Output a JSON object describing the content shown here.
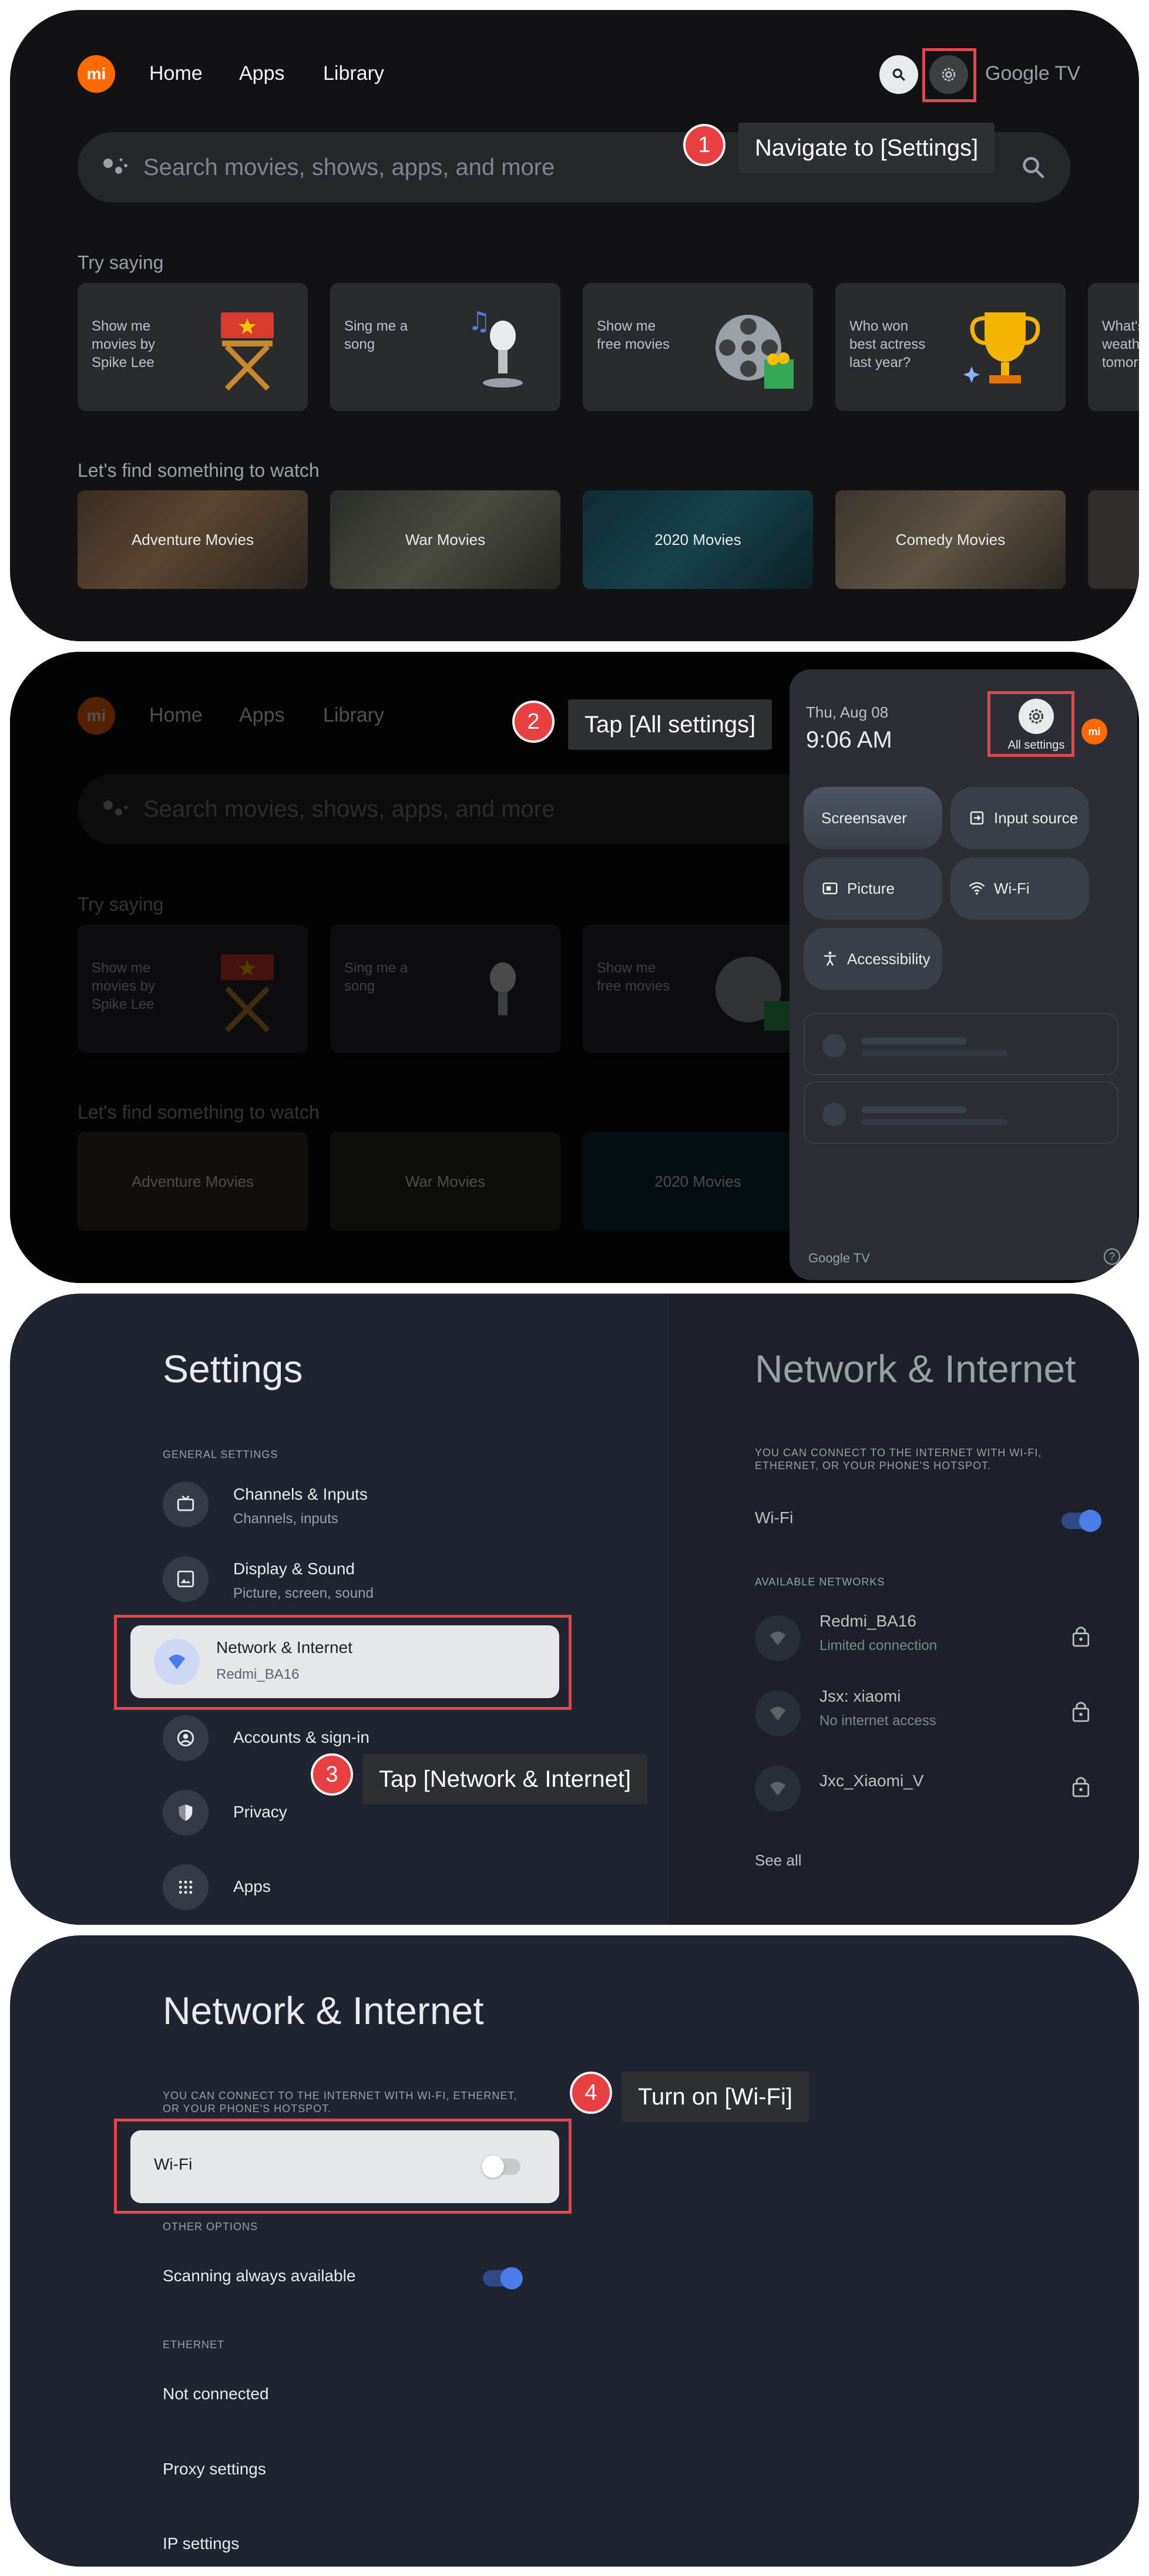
{
  "app": {
    "brand": "Google TV",
    "logo_text": "mi",
    "nav": [
      "Home",
      "Apps",
      "Library"
    ],
    "search_placeholder": "Search movies, shows, apps, and more"
  },
  "home": {
    "try_saying_title": "Try saying",
    "suggestions": [
      {
        "lines": [
          "Show me",
          "movies by",
          "Spike Lee"
        ],
        "icon": "directors-chair-icon"
      },
      {
        "lines": [
          "Sing me a",
          "song"
        ],
        "icon": "microphone-music-icon"
      },
      {
        "lines": [
          "Show me",
          "free movies"
        ],
        "icon": "film-reel-popcorn-icon"
      },
      {
        "lines": [
          "Who won",
          "best actress",
          "last year?"
        ],
        "icon": "trophy-icon"
      },
      {
        "lines": [
          "What's the",
          "weather",
          "tomorrow?"
        ],
        "icon": ""
      }
    ],
    "watch_title": "Let's find something to watch",
    "categories": [
      "Adventure Movies",
      "War Movies",
      "2020 Movies",
      "Comedy Movies"
    ]
  },
  "quick_settings": {
    "date": "Thu, Aug 08",
    "time": "9:06 AM",
    "all_settings_label": "All settings",
    "tiles": [
      "Screensaver",
      "Input source",
      "Picture",
      "Wi-Fi",
      "Accessibility"
    ],
    "footer_brand": "Google TV",
    "footer_help": "?"
  },
  "settings": {
    "title": "Settings",
    "general_header": "GENERAL SETTINGS",
    "items": [
      {
        "title": "Channels & Inputs",
        "subtitle": "Channels, inputs",
        "icon": "tv-icon"
      },
      {
        "title": "Display & Sound",
        "subtitle": "Picture, screen, sound",
        "icon": "image-icon"
      },
      {
        "title": "Network & Internet",
        "subtitle": "Redmi_BA16",
        "icon": "wifi-icon"
      },
      {
        "title": "Accounts & sign-in",
        "subtitle": "",
        "icon": "account-icon"
      },
      {
        "title": "Privacy",
        "subtitle": "",
        "icon": "shield-icon"
      },
      {
        "title": "Apps",
        "subtitle": "",
        "icon": "apps-grid-icon"
      }
    ]
  },
  "network": {
    "title": "Network & Internet",
    "description": "YOU CAN CONNECT TO THE INTERNET WITH WI-FI, ETHERNET, OR YOUR PHONE'S HOTSPOT.",
    "wifi_label": "Wi-Fi",
    "available_header": "AVAILABLE NETWORKS",
    "networks": [
      {
        "name": "Redmi_BA16",
        "status": "Limited connection"
      },
      {
        "name": "Jsx: xiaomi",
        "status": "No internet access"
      },
      {
        "name": "Jxc_Xiaomi_V",
        "status": ""
      }
    ],
    "see_all": "See all",
    "other_options_header": "OTHER OPTIONS",
    "scanning_label": "Scanning always available",
    "ethernet_header": "ETHERNET",
    "not_connected": "Not connected",
    "proxy_settings": "Proxy settings",
    "ip_settings": "IP settings",
    "wifi_on_preview": true,
    "wifi_on_final": false,
    "scanning_on": true
  },
  "steps": [
    {
      "number": "1",
      "label": "Navigate to [Settings]"
    },
    {
      "number": "2",
      "label": "Tap [All settings]"
    },
    {
      "number": "3",
      "label": "Tap [Network & Internet]"
    },
    {
      "number": "4",
      "label": "Turn on [Wi-Fi]"
    }
  ],
  "colors": {
    "accent_blue": "#4a7de8",
    "highlight_red": "#e0474c",
    "step_red": "#e84040",
    "brand_orange": "#ff6900"
  }
}
